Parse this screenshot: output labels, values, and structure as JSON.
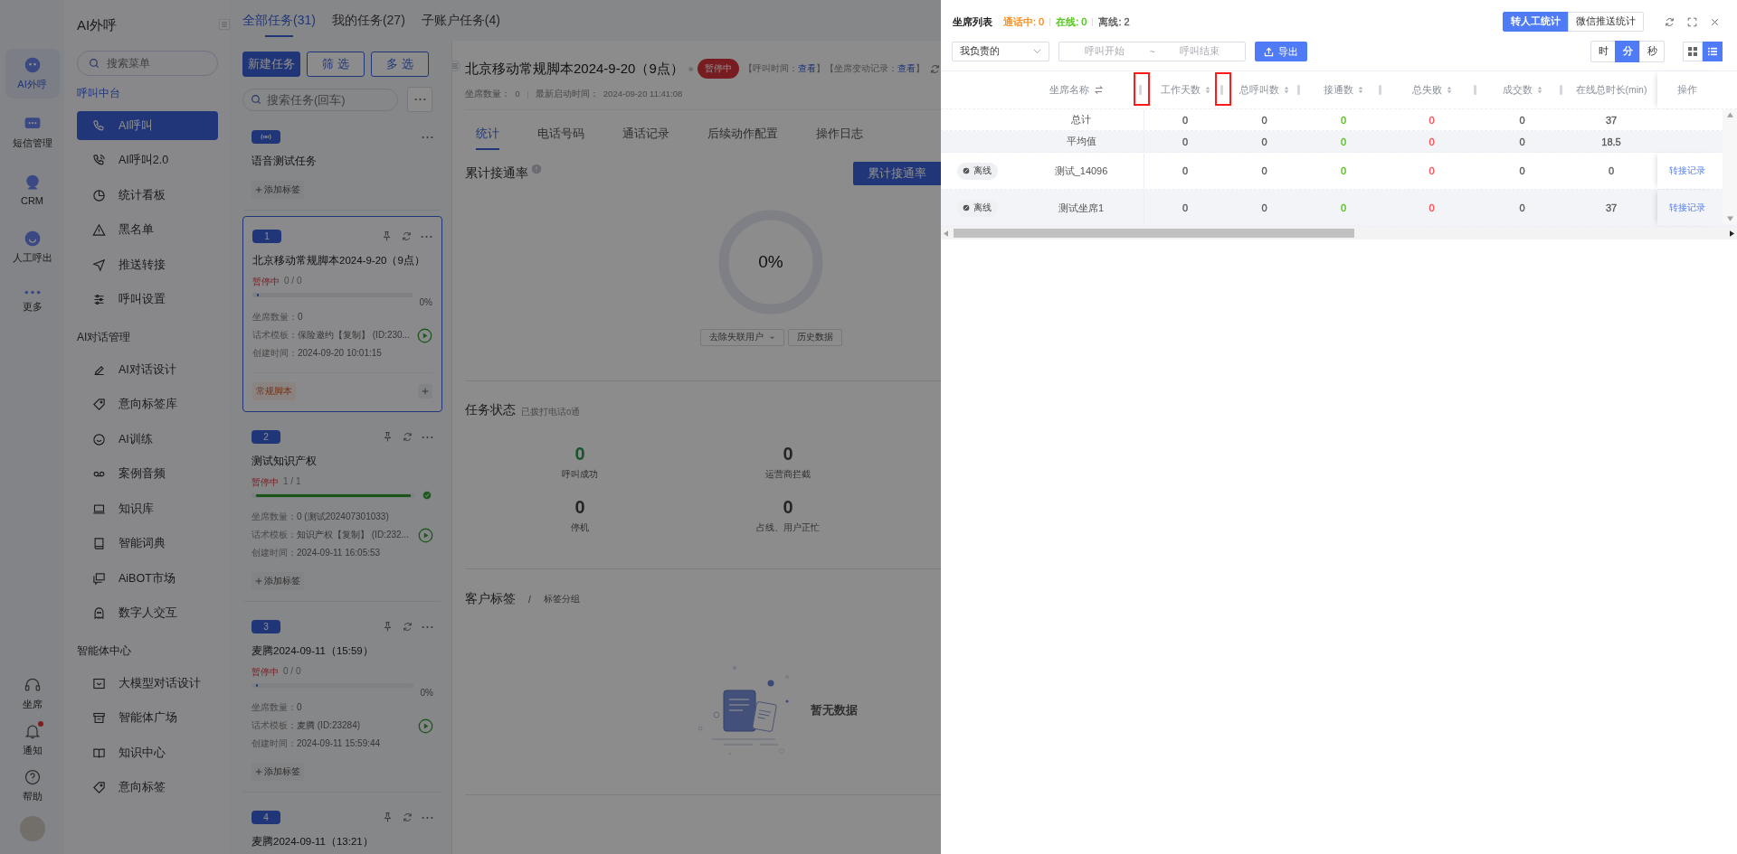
{
  "rail": {
    "items": [
      {
        "label": "AI外呼",
        "selected": true
      },
      {
        "label": "短信管理",
        "selected": false
      },
      {
        "label": "CRM",
        "selected": false
      },
      {
        "label": "人工呼出",
        "selected": false
      }
    ],
    "more": "更多",
    "bottom": [
      {
        "label": "坐席",
        "dot": false
      },
      {
        "label": "通知",
        "dot": true
      },
      {
        "label": "帮助",
        "dot": false
      }
    ]
  },
  "menu": {
    "title": "AI外呼",
    "search": {
      "placeholder": "搜索菜单"
    },
    "groups": [
      {
        "title": "呼叫中台",
        "items": [
          {
            "label": "AI呼叫",
            "selected": true
          },
          {
            "label": "AI呼叫2.0",
            "selected": false
          },
          {
            "label": "统计看板",
            "selected": false
          },
          {
            "label": "黑名单",
            "selected": false
          },
          {
            "label": "推送转接",
            "selected": false
          },
          {
            "label": "呼叫设置",
            "selected": false
          }
        ]
      },
      {
        "title": "AI对话管理",
        "items": [
          {
            "label": "AI对话设计",
            "selected": false
          },
          {
            "label": "意向标签库",
            "selected": false
          },
          {
            "label": "AI训练",
            "selected": false
          },
          {
            "label": "案例音频",
            "selected": false
          },
          {
            "label": "知识库",
            "selected": false
          },
          {
            "label": "智能词典",
            "selected": false
          },
          {
            "label": "AiBOT市场",
            "selected": false
          },
          {
            "label": "数字人交互",
            "selected": false
          }
        ]
      },
      {
        "title": "智能体中心",
        "items": [
          {
            "label": "大模型对话设计",
            "selected": false
          },
          {
            "label": "智能体广场",
            "selected": false
          },
          {
            "label": "知识中心",
            "selected": false
          },
          {
            "label": "意向标签",
            "selected": false
          }
        ]
      }
    ]
  },
  "tasks": {
    "tabs": [
      {
        "label": "全部任务(31)",
        "selected": true
      },
      {
        "label": "我的任务(27)",
        "selected": false
      },
      {
        "label": "子账户任务(4)",
        "selected": false
      }
    ],
    "buttons": [
      {
        "label": "新建任务",
        "kind": "primary"
      },
      {
        "label": "筛 选",
        "kind": "outline"
      },
      {
        "label": "多 选",
        "kind": "outline"
      }
    ],
    "search": {
      "placeholder": "搜索任务(回车)"
    },
    "cards": [
      {
        "kind": "voice",
        "selected": false,
        "title": "语音测试任务",
        "add_label": "添加标签"
      },
      {
        "kind": "task",
        "badge": "1",
        "selected": true,
        "title": "北京移动常规脚本2024-9-20（9点）",
        "status": "暂停中",
        "count": "0 / 0",
        "level": 0,
        "done": false,
        "percent": "0%",
        "fields": [
          {
            "label": "坐席数量：",
            "value": "0"
          },
          {
            "label": "话术模板：",
            "value": "保险邀约【复制】 (ID:230..."
          },
          {
            "label": "创建时间：",
            "value": "2024-09-20 10:01:15"
          }
        ],
        "tags": [
          "常规脚本"
        ]
      },
      {
        "kind": "task",
        "badge": "2",
        "selected": false,
        "title": "测试知识产权",
        "status": "暂停中",
        "count": "1 / 1",
        "level": 1,
        "done": true,
        "fields": [
          {
            "label": "坐席数量：",
            "value": "0 (测试202407301033)"
          },
          {
            "label": "话术模板：",
            "value": "知识产权【复制】 (ID:232..."
          },
          {
            "label": "创建时间：",
            "value": "2024-09-11 16:05:53"
          }
        ],
        "add_label": "添加标签"
      },
      {
        "kind": "task",
        "badge": "3",
        "selected": false,
        "title": "麦腾2024-09-11（15:59）",
        "status": "暂停中",
        "count": "0 / 0",
        "level": 0,
        "done": false,
        "percent": "0%",
        "fields": [
          {
            "label": "坐席数量：",
            "value": "0"
          },
          {
            "label": "话术模板：",
            "value": "麦腾 (ID:23284)"
          },
          {
            "label": "创建时间：",
            "value": "2024-09-11 15:59:44"
          }
        ],
        "add_label": "添加标签"
      },
      {
        "kind": "task",
        "badge": "4",
        "selected": false,
        "title": "麦腾2024-09-11（13:21）"
      }
    ]
  },
  "detail": {
    "title": "北京移动常规脚本2024-9-20（9点）",
    "status": "暂停中",
    "meta": [
      {
        "kind": "text",
        "text": "【呼叫时间："
      },
      {
        "kind": "link",
        "text": "查看"
      },
      {
        "kind": "text",
        "text": "】【坐席变动记录："
      },
      {
        "kind": "link",
        "text": "查看"
      },
      {
        "kind": "text",
        "text": "】"
      }
    ],
    "info": [
      {
        "label": "坐席数量：",
        "value": "0"
      },
      {
        "label": "最新启动时间：",
        "value": "2024-09-20 11:41:08"
      }
    ],
    "tabs": [
      {
        "label": "统计",
        "selected": true
      },
      {
        "label": "电话号码",
        "selected": false
      },
      {
        "label": "通话记录",
        "selected": false
      },
      {
        "label": "后续动作配置",
        "selected": false
      },
      {
        "label": "操作日志",
        "selected": false
      }
    ],
    "rate": {
      "title": "累计接通率",
      "button": "累计接通率",
      "value": "0%",
      "level": 0,
      "filter": "去除失联用户",
      "history": "历史数据"
    },
    "status_section": {
      "title": "任务状态",
      "note": "已拨打电话0通",
      "stats": [
        {
          "value": "0",
          "label": "呼叫成功",
          "kind": "success"
        },
        {
          "value": "0",
          "label": "运营商拦截",
          "kind": "plain"
        },
        {
          "value": "0",
          "label": "停机",
          "kind": "plain"
        },
        {
          "value": "0",
          "label": "占线、用户正忙",
          "kind": "plain"
        }
      ]
    },
    "tags_section": {
      "title": "客户标签",
      "separator": "/",
      "sub": "标签分组",
      "empty": "暂无数据"
    }
  },
  "drawer": {
    "title": "坐席列表",
    "counts": [
      {
        "label": "通话中: 0",
        "color": "#fa8c16"
      },
      {
        "label": "在线: 0",
        "color": "#52c41a"
      },
      {
        "label": "离线: 2",
        "color": "#595959"
      }
    ],
    "modes": [
      {
        "label": "转人工统计",
        "selected": true
      },
      {
        "label": "微信推送统计",
        "selected": false
      }
    ],
    "filter": "我负责的",
    "range": {
      "start": "呼叫开始",
      "sep": "~",
      "end": "呼叫结束"
    },
    "export": "导出",
    "units": [
      {
        "label": "时",
        "selected": false
      },
      {
        "label": "分",
        "selected": true
      },
      {
        "label": "秒",
        "selected": false
      }
    ],
    "views": [
      {
        "kind": "grid",
        "selected": false
      },
      {
        "kind": "list",
        "selected": true
      }
    ],
    "table": {
      "columns": [
        {
          "label": "坐席名称",
          "kind": "swap",
          "highlighted": true
        },
        {
          "label": "工作天数",
          "kind": "sort",
          "highlighted": true,
          "color": "#595959"
        },
        {
          "label": "总呼叫数",
          "kind": "sort",
          "highlighted": false,
          "color": "#595959"
        },
        {
          "label": "接通数",
          "kind": "sort",
          "highlighted": false,
          "color": "#52c41a"
        },
        {
          "label": "总失败",
          "kind": "sort",
          "highlighted": false,
          "color": "#ff4d4f"
        },
        {
          "label": "成交数",
          "kind": "sort",
          "highlighted": false,
          "color": "#595959"
        },
        {
          "label": "在线总时长(min)",
          "kind": "plain",
          "highlighted": false,
          "color": "#595959"
        },
        {
          "label": "操作",
          "kind": "action",
          "highlighted": false
        }
      ],
      "rows": [
        {
          "kind": "summary",
          "name": "总计",
          "values": [
            "0",
            "0",
            "0",
            "0",
            "0",
            "37"
          ]
        },
        {
          "kind": "summary",
          "name": "平均值",
          "values": [
            "0",
            "0",
            "0",
            "0",
            "0",
            "18.5"
          ]
        },
        {
          "kind": "agent",
          "status": "离线",
          "name": "测试_14096",
          "values": [
            "0",
            "0",
            "0",
            "0",
            "0",
            "0"
          ],
          "action": "转接记录"
        },
        {
          "kind": "agent",
          "status": "离线",
          "name": "测试坐席1",
          "values": [
            "0",
            "0",
            "0",
            "0",
            "0",
            "37"
          ],
          "action": "转接记录"
        }
      ]
    }
  }
}
